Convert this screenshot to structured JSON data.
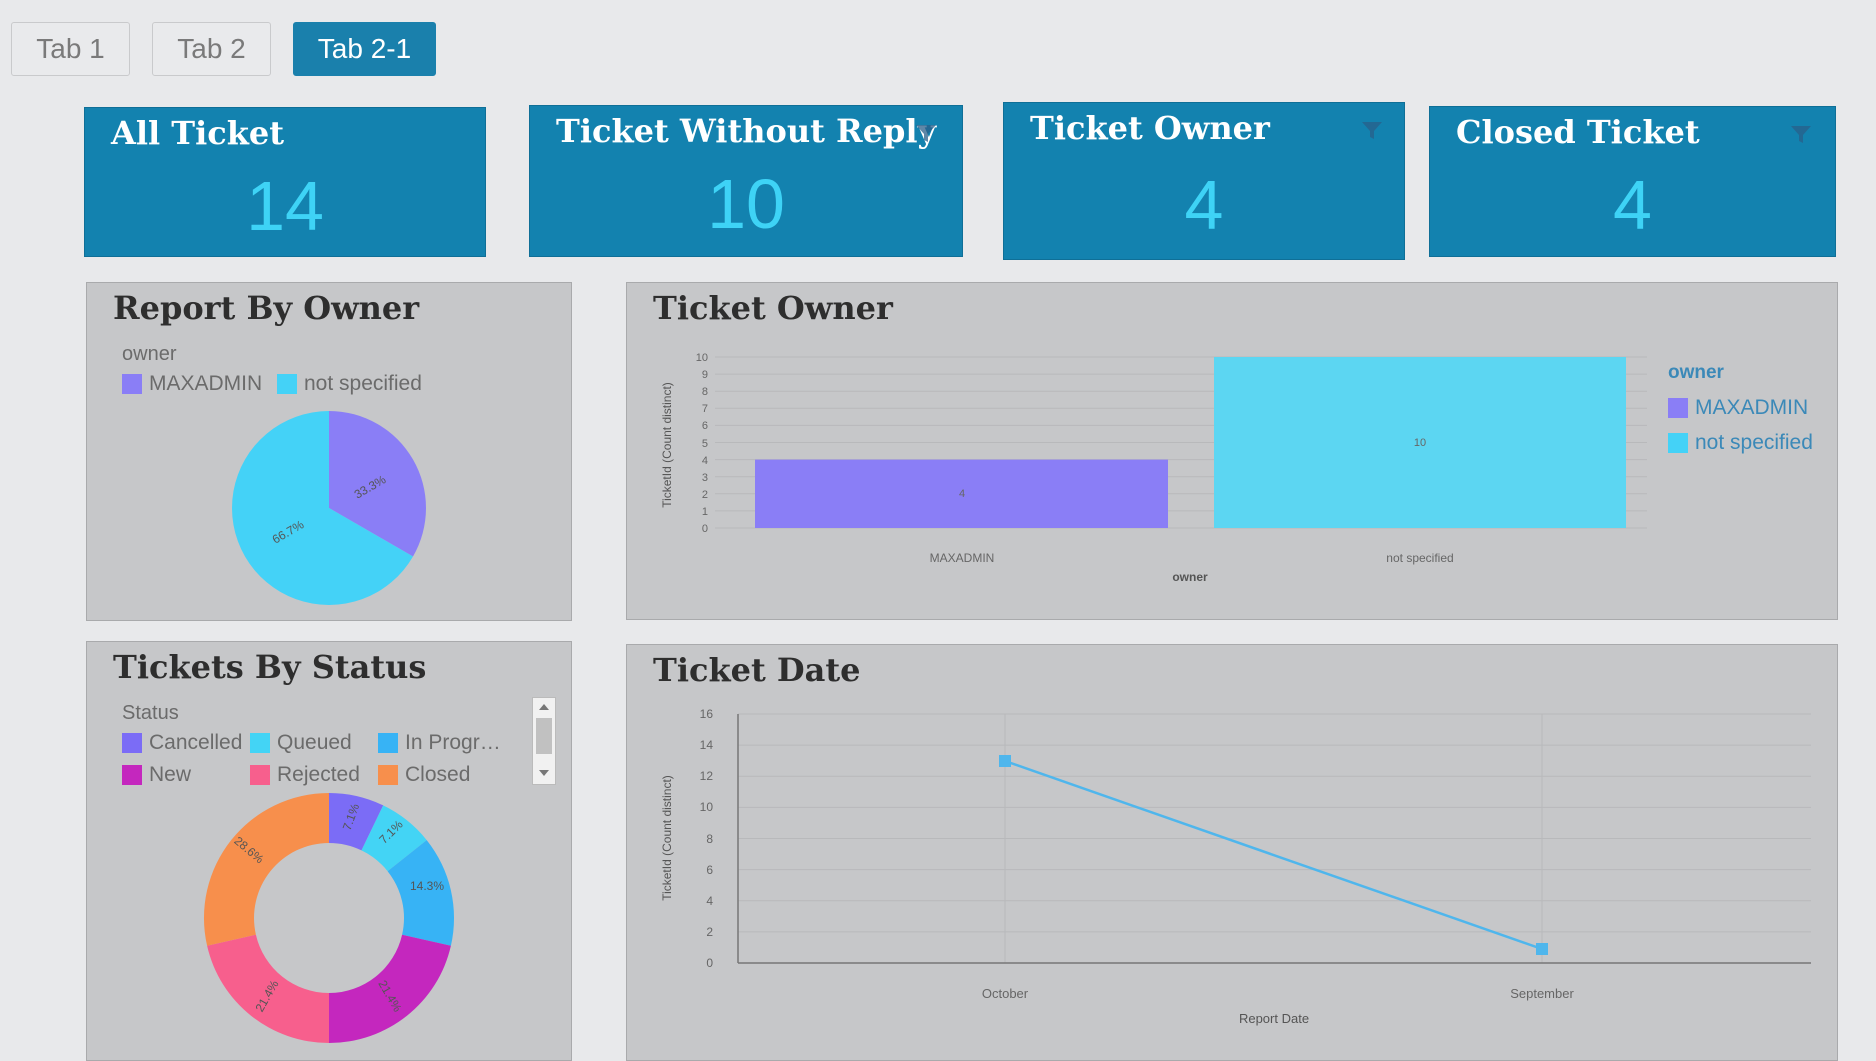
{
  "tabs": [
    "Tab 1",
    "Tab 2",
    "Tab 2-1"
  ],
  "active_tab": "Tab 2-1",
  "kpis": [
    {
      "title": "All Ticket",
      "value": "14"
    },
    {
      "title": "Ticket Without Reply",
      "value": "10"
    },
    {
      "title": "Ticket Owner",
      "value": "4"
    },
    {
      "title": "Closed Ticket",
      "value": "4"
    }
  ],
  "colors": {
    "maxadmin": "#8a7ef6",
    "not_specified": "#44d2f7",
    "cancelled": "#7b6cf6",
    "queued": "#43d4f5",
    "in_progress": "#37b3f5",
    "new": "#c427be",
    "rejected": "#f75f8d",
    "closed": "#f78f4c",
    "line": "#4fb6ec",
    "kpi_bg": "#1382af",
    "kpi_value": "#3ed3f6"
  },
  "report_by_owner": {
    "title": "Report By Owner",
    "legend_title": "owner",
    "legend": [
      "MAXADMIN",
      "not specified"
    ]
  },
  "tickets_by_status": {
    "title": "Tickets By Status",
    "legend_title": "Status",
    "legend": [
      "Cancelled",
      "Queued",
      "In Progr…",
      "New",
      "Rejected",
      "Closed"
    ]
  },
  "ticket_owner_chart": {
    "title": "Ticket Owner",
    "legend_title": "owner",
    "legend": [
      "MAXADMIN",
      "not specified"
    ]
  },
  "ticket_date_chart": {
    "title": "Ticket Date"
  },
  "chart_data": [
    {
      "type": "pie",
      "title": "Report By Owner",
      "legend_title": "owner",
      "categories": [
        "MAXADMIN",
        "not specified"
      ],
      "values": [
        33.3,
        66.7
      ],
      "labels": [
        "33.3%",
        "66.7%"
      ]
    },
    {
      "type": "pie",
      "variant": "donut",
      "title": "Tickets By Status",
      "legend_title": "Status",
      "categories": [
        "Cancelled",
        "Queued",
        "In Progress",
        "New",
        "Rejected",
        "Closed"
      ],
      "values": [
        7.1,
        7.1,
        14.3,
        21.4,
        21.4,
        28.6
      ],
      "labels": [
        "7.1%",
        "7.1%",
        "14.3%",
        "21.4%",
        "21.4%",
        "28.6%"
      ]
    },
    {
      "type": "bar",
      "title": "Ticket Owner",
      "categories": [
        "MAXADMIN",
        "not specified"
      ],
      "values": [
        4,
        10
      ],
      "value_labels": [
        "4",
        "10"
      ],
      "xlabel": "owner",
      "ylabel": "TicketId (Count distinct)",
      "ylim": [
        0,
        10
      ],
      "yticks": [
        "0",
        "1",
        "2",
        "3",
        "4",
        "5",
        "6",
        "7",
        "8",
        "9",
        "10"
      ],
      "legend": "right"
    },
    {
      "type": "line",
      "title": "Ticket Date",
      "categories": [
        "October",
        "September"
      ],
      "values": [
        13,
        1
      ],
      "xlabel": "Report Date",
      "ylabel": "TicketId (Count distinct)",
      "ylim": [
        0,
        16
      ],
      "yticks": [
        "0",
        "2",
        "4",
        "6",
        "8",
        "10",
        "12",
        "14",
        "16"
      ],
      "grid": true
    }
  ]
}
